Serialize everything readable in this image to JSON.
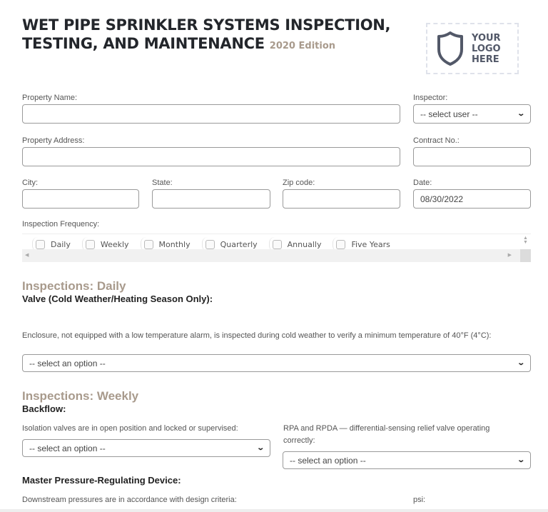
{
  "header": {
    "title_line1": "WET PIPE SPRINKLER SYSTEMS INSPECTION,",
    "title_line2": "TESTING, AND MAINTENANCE",
    "edition": "2020 Edition",
    "logo_text": [
      "YOUR",
      "LOGO",
      "HERE"
    ],
    "logo_icon": "shield-icon"
  },
  "form": {
    "property_name": {
      "label": "Property Name:",
      "value": ""
    },
    "inspector": {
      "label": "Inspector:",
      "selected": "-- select user --"
    },
    "property_address": {
      "label": "Property Address:",
      "value": ""
    },
    "contract_no": {
      "label": "Contract No.:",
      "value": ""
    },
    "city": {
      "label": "City:",
      "value": ""
    },
    "state": {
      "label": "State:",
      "value": ""
    },
    "zip_code": {
      "label": "Zip code:",
      "value": ""
    },
    "date": {
      "label": "Date:",
      "value": "08/30/2022"
    }
  },
  "frequency": {
    "label": "Inspection Frequency:",
    "options": [
      {
        "label": "Daily",
        "checked": false
      },
      {
        "label": "Weekly",
        "checked": false
      },
      {
        "label": "Monthly",
        "checked": false
      },
      {
        "label": "Quarterly",
        "checked": false
      },
      {
        "label": "Annually",
        "checked": false
      },
      {
        "label": "Five Years",
        "checked": false
      }
    ]
  },
  "daily": {
    "title": "Inspections: Daily",
    "subtitle": "Valve (Cold Weather/Heating Season Only):",
    "question": "Enclosure, not equipped with a low temperature alarm, is inspected during cold weather to verify a minimum temperature of 40°F (4°C):",
    "selected": "-- select an option --"
  },
  "weekly": {
    "title": "Inspections: Weekly",
    "backflow_title": "Backflow:",
    "q1": "Isolation valves are in open position and locked or supervised:",
    "q1_selected": "-- select an option --",
    "q2": "RPA and RPDA — differential-sensing relief valve operating correctly:",
    "q2_selected": "-- select an option --",
    "mprd_title": "Master Pressure-Regulating Device:",
    "q3": "Downstream pressures are in accordance with design criteria:",
    "psi_label": "psi:"
  },
  "colors": {
    "accent": "#a89a8c",
    "title": "#23262b",
    "logo": "#525868"
  }
}
